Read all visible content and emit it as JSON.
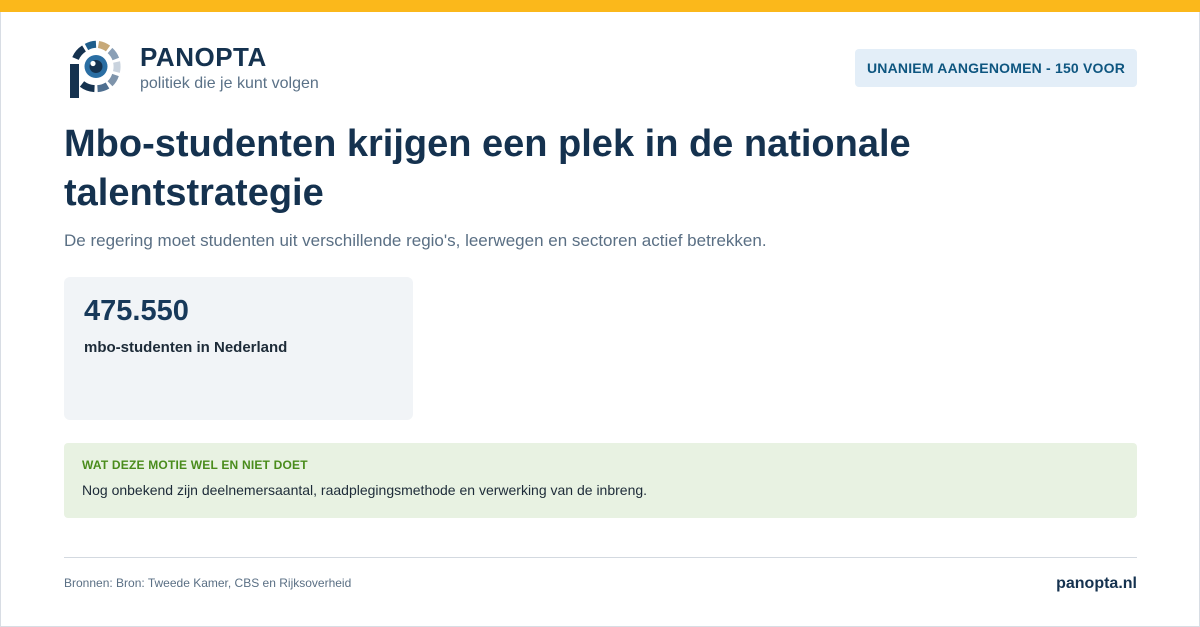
{
  "colors": {
    "accent_bar": "#fbb81b",
    "brand_navy": "#15324f",
    "badge_bg": "#e3eef8",
    "badge_text": "#0e5680",
    "info_bg": "#e8f2e2",
    "info_heading": "#4a8c1c"
  },
  "header": {
    "logo_icon": "panopta-eye-logo-icon",
    "brand_name": "PANOPTA",
    "tagline": "politiek die je kunt volgen",
    "status_badge": "UNANIEM AANGENOMEN - 150 VOOR"
  },
  "main": {
    "title": "Mbo-studenten krijgen een plek in de nationale talentstrategie",
    "subtitle": "De regering moet studenten uit verschillende regio's, leerwegen en sectoren actief betrekken.",
    "stat": {
      "value": "475.550",
      "label": "mbo-studenten in Nederland"
    },
    "info": {
      "heading": "WAT DEZE MOTIE WEL EN NIET DOET",
      "text": "Nog onbekend zijn deelnemersaantal, raadplegingsmethode en verwerking van de inbreng."
    }
  },
  "footer": {
    "sources": "Bronnen: Bron: Tweede Kamer, CBS en Rijksoverheid",
    "site": "panopta.nl"
  }
}
